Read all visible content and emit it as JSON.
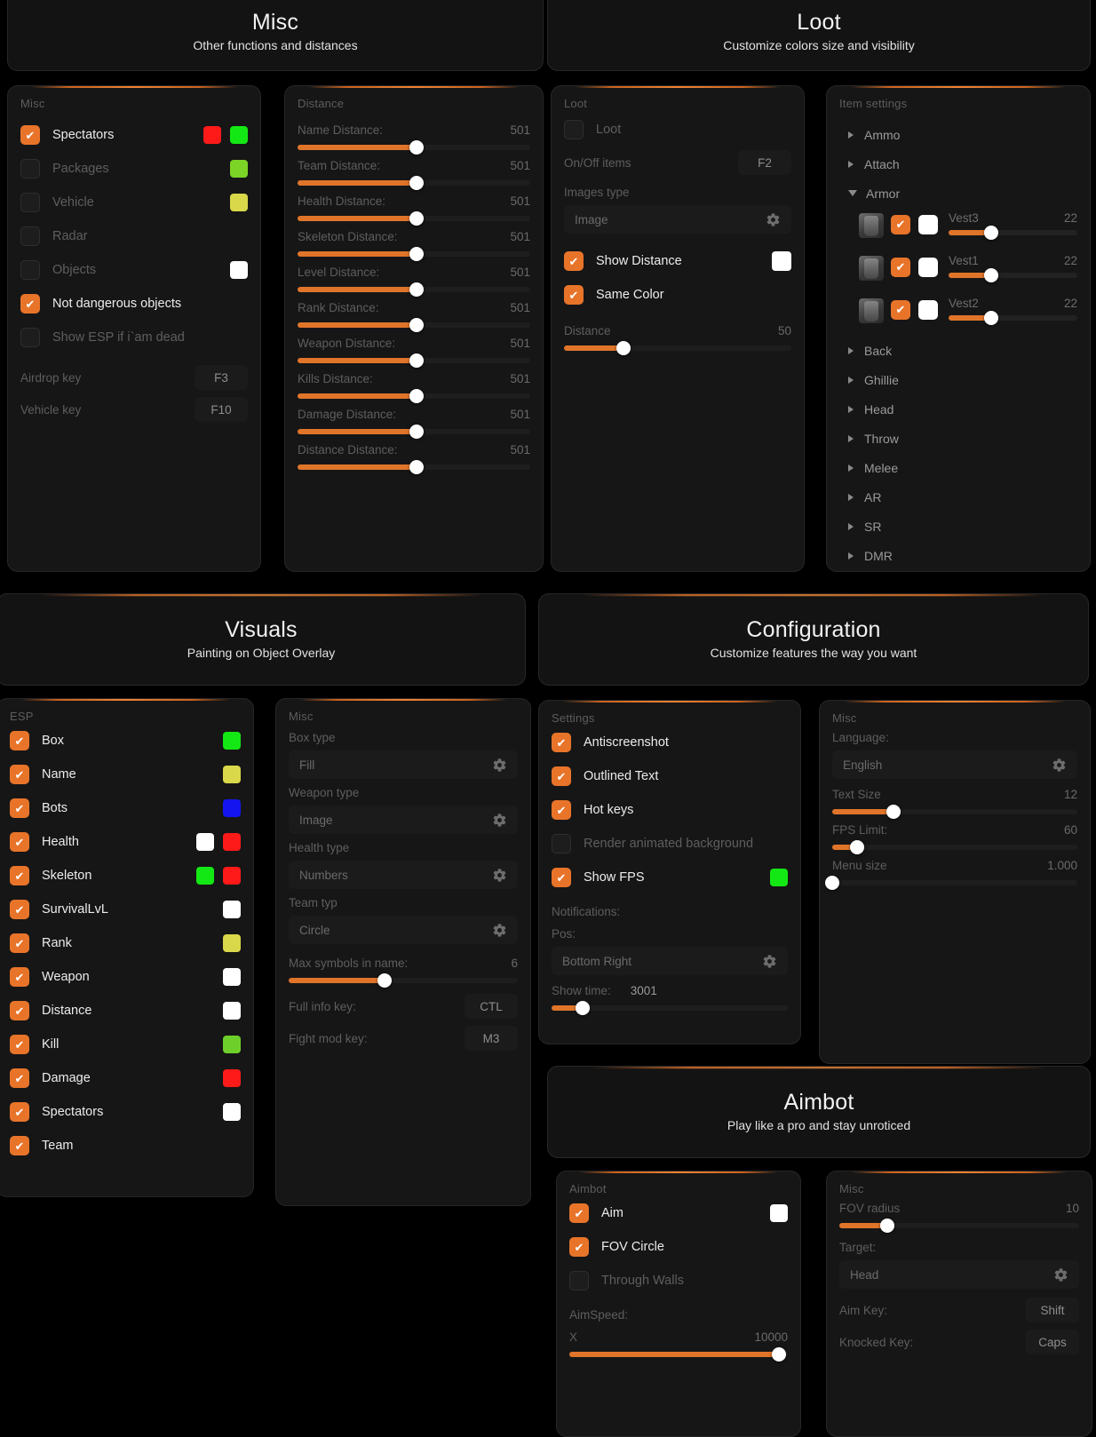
{
  "theme": {
    "accent": "#e8742a",
    "panel_bg": "#161616",
    "page_bg": "#000000"
  },
  "sections": {
    "misc": {
      "title": "Misc",
      "subtitle": "Other functions and distances"
    },
    "loot": {
      "title": "Loot",
      "subtitle": "Customize colors size and visibility"
    },
    "visuals": {
      "title": "Visuals",
      "subtitle": "Painting on Object Overlay"
    },
    "config": {
      "title": "Configuration",
      "subtitle": "Customize features the way you want"
    },
    "aimbot": {
      "title": "Aimbot",
      "subtitle": "Play like a pro and stay unroticed"
    }
  },
  "misc_panel": {
    "label": "Misc",
    "toggles": [
      {
        "label": "Spectators",
        "checked": true,
        "colors": [
          "#ff1a1a",
          "#14e814"
        ]
      },
      {
        "label": "Packages",
        "checked": false,
        "colors": [
          "#7bd426"
        ]
      },
      {
        "label": "Vehicle",
        "checked": false,
        "colors": [
          "#d8d84a"
        ]
      },
      {
        "label": "Radar",
        "checked": false,
        "colors": []
      },
      {
        "label": "Objects",
        "checked": false,
        "colors": [
          "#ffffff"
        ]
      },
      {
        "label": "Not dangerous objects",
        "checked": true,
        "colors": []
      },
      {
        "label": "Show ESP if i`am dead",
        "checked": false,
        "colors": []
      }
    ],
    "keys": [
      {
        "label": "Airdrop key",
        "value": "F3"
      },
      {
        "label": "Vehicle key",
        "value": "F10"
      }
    ]
  },
  "distance_panel": {
    "label": "Distance",
    "sliders": [
      {
        "name": "Name Distance:",
        "value": "501",
        "pct": 51
      },
      {
        "name": "Team Distance:",
        "value": "501",
        "pct": 51
      },
      {
        "name": "Health Distance:",
        "value": "501",
        "pct": 51
      },
      {
        "name": "Skeleton Distance:",
        "value": "501",
        "pct": 51
      },
      {
        "name": "Level Distance:",
        "value": "501",
        "pct": 51
      },
      {
        "name": "Rank Distance:",
        "value": "501",
        "pct": 51
      },
      {
        "name": "Weapon Distance:",
        "value": "501",
        "pct": 51
      },
      {
        "name": "Kills Distance:",
        "value": "501",
        "pct": 51
      },
      {
        "name": "Damage Distance:",
        "value": "501",
        "pct": 51
      },
      {
        "name": "Distance Distance:",
        "value": "501",
        "pct": 51
      }
    ]
  },
  "loot_panel": {
    "label": "Loot",
    "loot_toggle": {
      "label": "Loot",
      "checked": false
    },
    "onoff_key": {
      "label": "On/Off items",
      "value": "F2"
    },
    "images_type": {
      "label": "Images type",
      "value": "Image"
    },
    "show_distance": {
      "label": "Show Distance",
      "checked": true,
      "color": "#ffffff"
    },
    "same_color": {
      "label": "Same Color",
      "checked": true
    },
    "distance": {
      "name": "Distance",
      "value": "50",
      "pct": 26
    }
  },
  "item_settings": {
    "label": "Item settings",
    "groups_before": [
      {
        "label": "Ammo",
        "open": false
      },
      {
        "label": "Attach",
        "open": false
      },
      {
        "label": "Armor",
        "open": true
      }
    ],
    "armor_items": [
      {
        "name": "Vest3",
        "value": "22",
        "checked": true,
        "color": "#ffffff",
        "pct": 33
      },
      {
        "name": "Vest1",
        "value": "22",
        "checked": true,
        "color": "#ffffff",
        "pct": 33
      },
      {
        "name": "Vest2",
        "value": "22",
        "checked": true,
        "color": "#ffffff",
        "pct": 33
      }
    ],
    "groups_after": [
      {
        "label": "Back",
        "open": false
      },
      {
        "label": "Ghillie",
        "open": false
      },
      {
        "label": "Head",
        "open": false
      },
      {
        "label": "Throw",
        "open": false
      },
      {
        "label": "Melee",
        "open": false
      },
      {
        "label": "AR",
        "open": false
      },
      {
        "label": "SR",
        "open": false
      },
      {
        "label": "DMR",
        "open": false
      }
    ]
  },
  "esp_panel": {
    "label": "ESP",
    "items": [
      {
        "label": "Box",
        "checked": true,
        "colors": [
          "#14e814"
        ]
      },
      {
        "label": "Name",
        "checked": true,
        "colors": [
          "#d8d84a"
        ]
      },
      {
        "label": "Bots",
        "checked": true,
        "colors": [
          "#1414f0"
        ]
      },
      {
        "label": "Health",
        "checked": true,
        "colors": [
          "#ffffff",
          "#ff1a1a"
        ]
      },
      {
        "label": "Skeleton",
        "checked": true,
        "colors": [
          "#14e814",
          "#ff1a1a"
        ]
      },
      {
        "label": "SurvivalLvL",
        "checked": true,
        "colors": [
          "#ffffff"
        ]
      },
      {
        "label": "Rank",
        "checked": true,
        "colors": [
          "#d8d84a"
        ]
      },
      {
        "label": "Weapon",
        "checked": true,
        "colors": [
          "#ffffff"
        ]
      },
      {
        "label": "Distance",
        "checked": true,
        "colors": [
          "#ffffff"
        ]
      },
      {
        "label": "Kill",
        "checked": true,
        "colors": [
          "#6fcf2a"
        ]
      },
      {
        "label": "Damage",
        "checked": true,
        "colors": [
          "#ff1a1a"
        ]
      },
      {
        "label": "Spectators",
        "checked": true,
        "colors": [
          "#ffffff"
        ]
      },
      {
        "label": "Team",
        "checked": true,
        "colors": []
      }
    ]
  },
  "visuals_misc": {
    "label": "Misc",
    "selects": [
      {
        "label": "Box type",
        "value": "Fill"
      },
      {
        "label": "Weapon type",
        "value": "Image"
      },
      {
        "label": "Health type",
        "value": "Numbers"
      },
      {
        "label": "Team typ",
        "value": "Circle"
      }
    ],
    "max_symbols": {
      "name": "Max symbols in name:",
      "value": "6",
      "pct": 42
    },
    "keys": [
      {
        "label": "Full info key:",
        "value": "CTL"
      },
      {
        "label": "Fight mod key:",
        "value": "M3"
      }
    ]
  },
  "settings_panel": {
    "label": "Settings",
    "toggles": [
      {
        "label": "Antiscreenshot",
        "checked": true,
        "color": null
      },
      {
        "label": "Outlined Text",
        "checked": true,
        "color": null
      },
      {
        "label": "Hot keys",
        "checked": true,
        "color": null
      },
      {
        "label": "Render animated background",
        "checked": false,
        "color": null
      },
      {
        "label": "Show FPS",
        "checked": true,
        "color": "#14e814"
      }
    ],
    "notifications_label": "Notifications:",
    "pos": {
      "label": "Pos:",
      "value": "Bottom Right"
    },
    "show_time": {
      "label": "Show time:",
      "value": "3001",
      "pct": 13
    }
  },
  "config_misc": {
    "label": "Misc",
    "language": {
      "label": "Language:",
      "value": "English"
    },
    "sliders": [
      {
        "name": "Text Size",
        "value": "12",
        "pct": 25
      },
      {
        "name": "FPS Limit:",
        "value": "60",
        "pct": 10
      },
      {
        "name": "Menu size",
        "value": "1.000",
        "pct": 0
      }
    ]
  },
  "aimbot_panel": {
    "label": "Aimbot",
    "toggles": [
      {
        "label": "Aim",
        "checked": true,
        "color": "#ffffff"
      },
      {
        "label": "FOV Circle",
        "checked": true,
        "color": null
      },
      {
        "label": "Through Walls",
        "checked": false,
        "color": null
      }
    ],
    "aimspeed_label": "AimSpeed:",
    "aimspeed_x": {
      "name": "X",
      "value": "10000",
      "pct": 96
    }
  },
  "aimbot_misc": {
    "label": "Misc",
    "fov_radius": {
      "name": "FOV radius",
      "value": "10",
      "pct": 20
    },
    "target": {
      "label": "Target:",
      "value": "Head"
    },
    "keys": [
      {
        "label": "Aim Key:",
        "value": "Shift"
      },
      {
        "label": "Knocked Key:",
        "value": "Caps"
      }
    ]
  }
}
